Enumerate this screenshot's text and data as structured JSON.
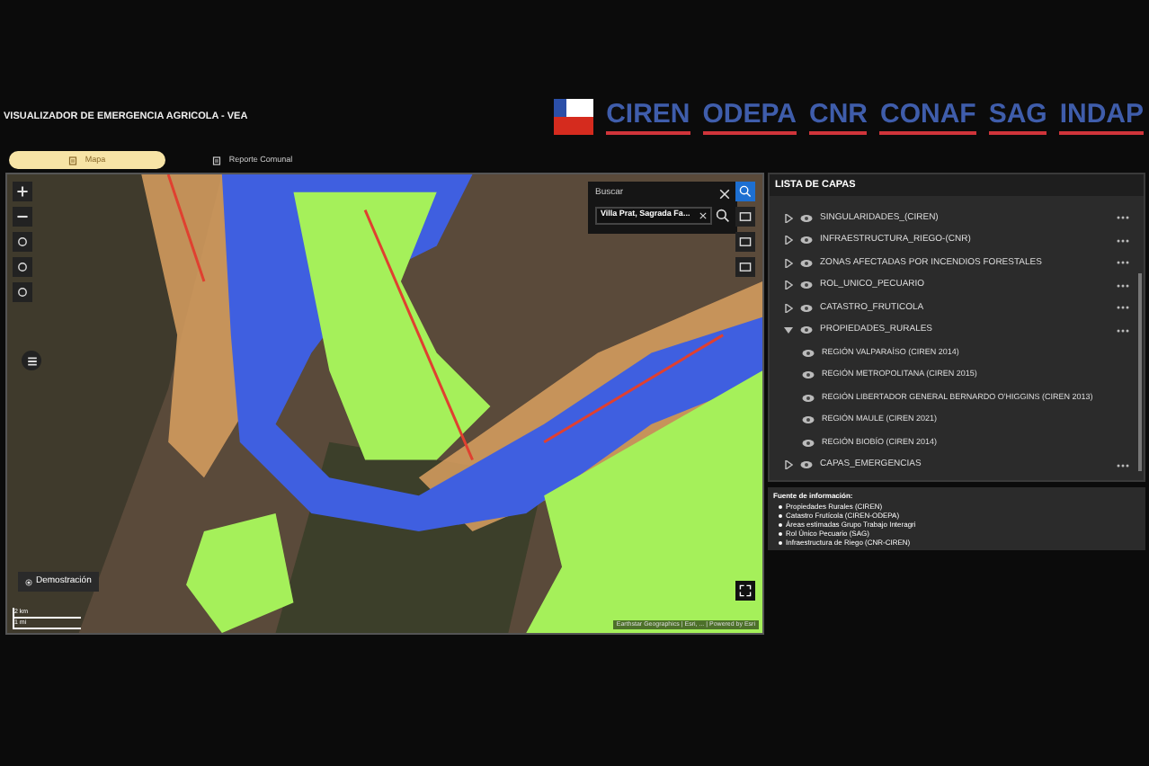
{
  "header": {
    "title": "VISUALIZADOR DE EMERGENCIA AGRICOLA - VEA",
    "logos": [
      "CIREN",
      "ODEPA",
      "CNR",
      "CONAF",
      "SAG",
      "INDAP"
    ]
  },
  "tabs": [
    {
      "label": "Mapa",
      "selected": true
    },
    {
      "label": "Reporte Comunal",
      "selected": false
    }
  ],
  "map": {
    "search": {
      "title": "Buscar",
      "value": "Villa Prat, Sagrada Fa..."
    },
    "demo_button": "Demostración",
    "scale": [
      "2 km",
      "1 mi"
    ],
    "attribution": "Earthstar Geographics | Esri, ... | Powered by Esri"
  },
  "layers_panel": {
    "title": "LISTA DE CAPAS",
    "layers": [
      {
        "label": "SINGULARIDADES_(CIREN)",
        "expanded": false
      },
      {
        "label": "INFRAESTRUCTURA_RIEGO-(CNR)",
        "expanded": false
      },
      {
        "label": "ZONAS AFECTADAS POR INCENDIOS FORESTALES",
        "expanded": false
      },
      {
        "label": "ROL_UNICO_PECUARIO",
        "expanded": false
      },
      {
        "label": "CATASTRO_FRUTICOLA",
        "expanded": false
      },
      {
        "label": "PROPIEDADES_RURALES",
        "expanded": true,
        "children": [
          {
            "label": "REGIÓN VALPARAÍSO (CIREN 2014)"
          },
          {
            "label": "REGIÓN METROPOLITANA (CIREN 2015)"
          },
          {
            "label": "REGIÓN LIBERTADOR GENERAL BERNARDO O'HIGGINS (CIREN 2013)"
          },
          {
            "label": "REGIÓN MAULE (CIREN 2021)"
          },
          {
            "label": "REGIÓN BIOBÍO (CIREN 2014)"
          }
        ]
      },
      {
        "label": "CAPAS_EMERGENCIAS",
        "expanded": false
      }
    ]
  },
  "sources": {
    "title": "Fuente de información:",
    "items": [
      "Propiedades Rurales (CIREN)",
      "Catastro Frutícola (CIREN-ODEPA)",
      "Áreas estimadas Grupo Trabajo Interagri",
      "Rol Único Pecuario (SAG)",
      "Infraestructura de Riego (CNR-CIREN)"
    ]
  }
}
